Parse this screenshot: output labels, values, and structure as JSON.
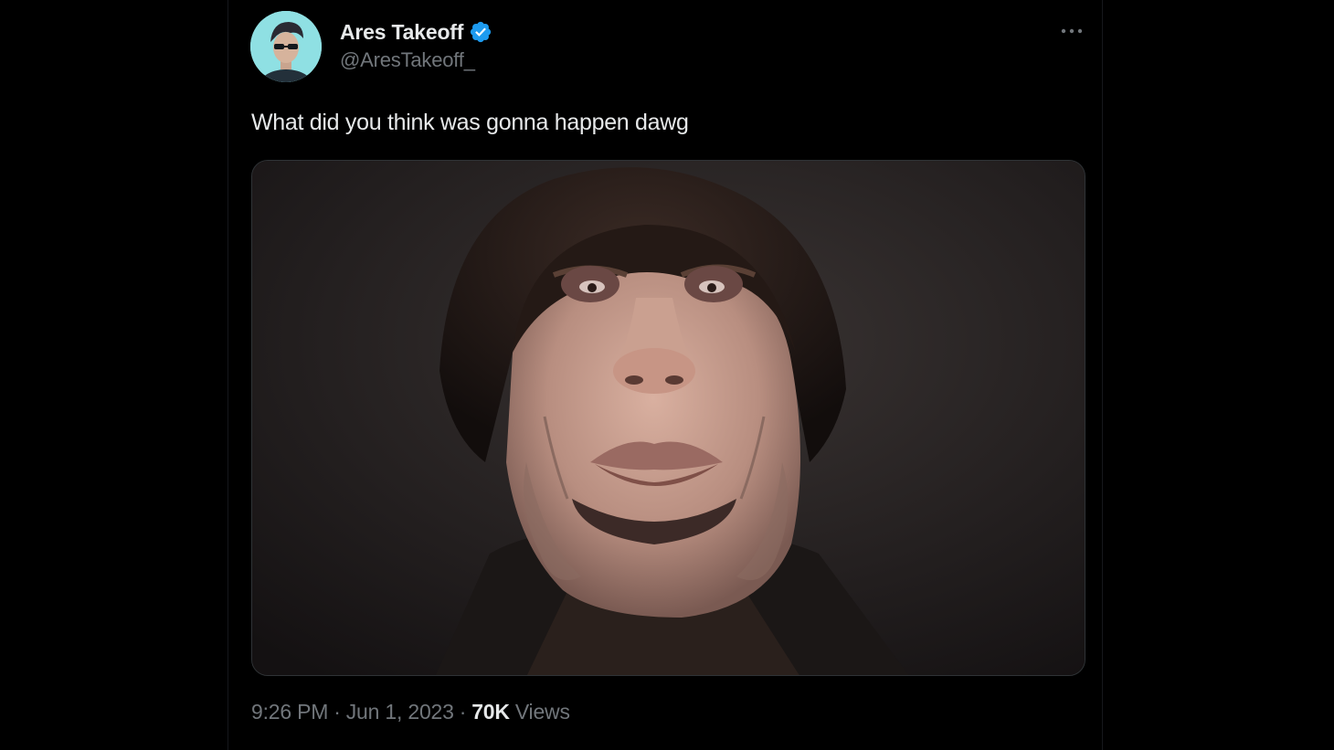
{
  "tweet": {
    "author_name": "Ares Takeoff",
    "author_handle": "@AresTakeoff_",
    "verified": true,
    "text": "What did you think was gonna happen dawg",
    "time": "9:26 PM",
    "date": "Jun 1, 2023",
    "views_count": "70K",
    "views_label": "Views",
    "separator": "·",
    "more_label": "···"
  },
  "icons": {
    "verified": "verified-badge-icon",
    "more": "more-dots-icon"
  },
  "colors": {
    "background": "#000000",
    "primary_text": "#e7e9ea",
    "secondary_text": "#71767b",
    "verified_blue": "#1d9bf0",
    "border": "#2f3336"
  }
}
